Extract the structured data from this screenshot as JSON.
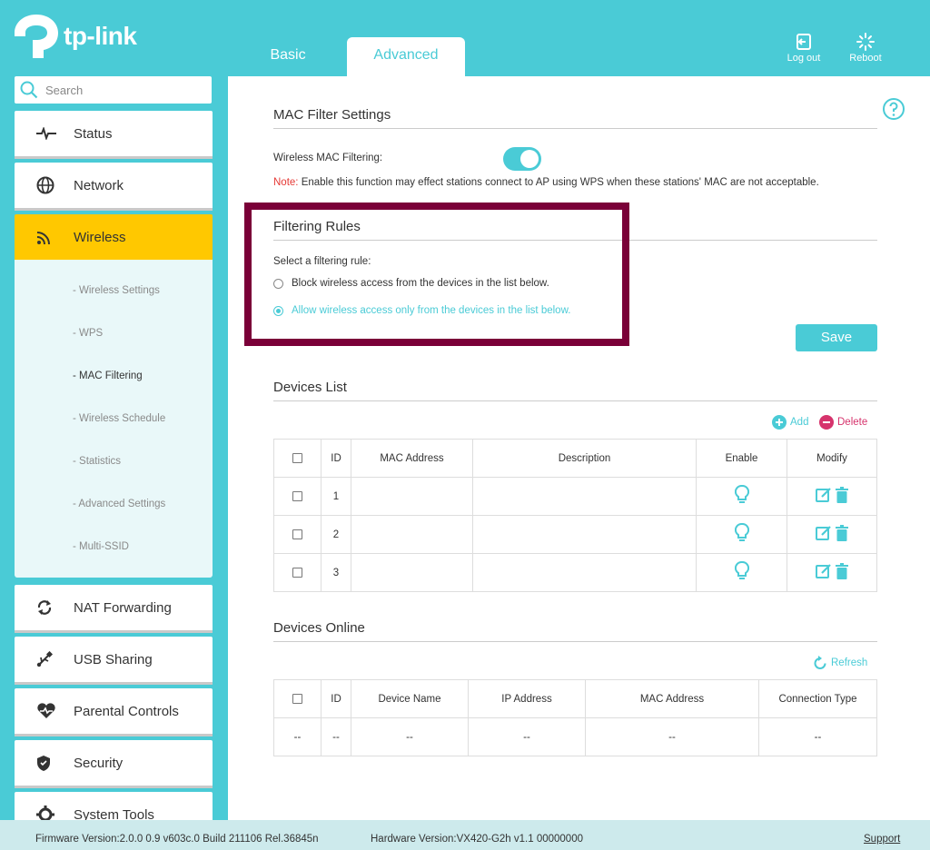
{
  "brand": "tp-link",
  "tabs": {
    "basic": "Basic",
    "advanced": "Advanced"
  },
  "header": {
    "logout": "Log out",
    "reboot": "Reboot"
  },
  "search": {
    "placeholder": "Search"
  },
  "sidebar": {
    "items": [
      {
        "label": "Status",
        "icon": "pulse-icon"
      },
      {
        "label": "Network",
        "icon": "globe-icon"
      },
      {
        "label": "Wireless",
        "icon": "wifi-icon"
      },
      {
        "label": "NAT Forwarding",
        "icon": "nat-icon"
      },
      {
        "label": "USB Sharing",
        "icon": "usb-icon"
      },
      {
        "label": "Parental Controls",
        "icon": "heart-icon"
      },
      {
        "label": "Security",
        "icon": "shield-icon"
      },
      {
        "label": "System Tools",
        "icon": "gear-icon"
      }
    ],
    "wireless_sub": [
      "- Wireless Settings",
      "- WPS",
      "- MAC Filtering",
      "- Wireless Schedule",
      "- Statistics",
      "- Advanced Settings",
      "- Multi-SSID"
    ]
  },
  "mac_filter": {
    "title": "MAC Filter Settings",
    "field_label": "Wireless MAC Filtering:",
    "note_key": "Note:",
    "note_text": " Enable this function may effect stations connect to AP using WPS when these stations' MAC are not acceptable."
  },
  "filtering_rules": {
    "title": "Filtering Rules",
    "prompt": "Select a filtering rule:",
    "option_block": "Block wireless access from the devices in the list below.",
    "option_allow": "Allow wireless access only from the devices in the list below.",
    "save": "Save"
  },
  "devices_list": {
    "title": "Devices List",
    "add": "Add",
    "delete": "Delete",
    "columns": [
      "ID",
      "MAC Address",
      "Description",
      "Enable",
      "Modify"
    ],
    "rows": [
      "1",
      "2",
      "3"
    ]
  },
  "devices_online": {
    "title": "Devices Online",
    "refresh": "Refresh",
    "columns": [
      "ID",
      "Device Name",
      "IP Address",
      "MAC Address",
      "Connection Type"
    ],
    "empty": "--"
  },
  "footer": {
    "firmware": "Firmware Version:2.0.0 0.9 v603c.0 Build 211106 Rel.36845n",
    "hardware": "Hardware Version:VX420-G2h v1.1 00000000",
    "support": "Support"
  },
  "colors": {
    "accent": "#4acbd6",
    "active": "#ffc800",
    "highlight": "#7a0038",
    "delete": "#d6336c"
  }
}
